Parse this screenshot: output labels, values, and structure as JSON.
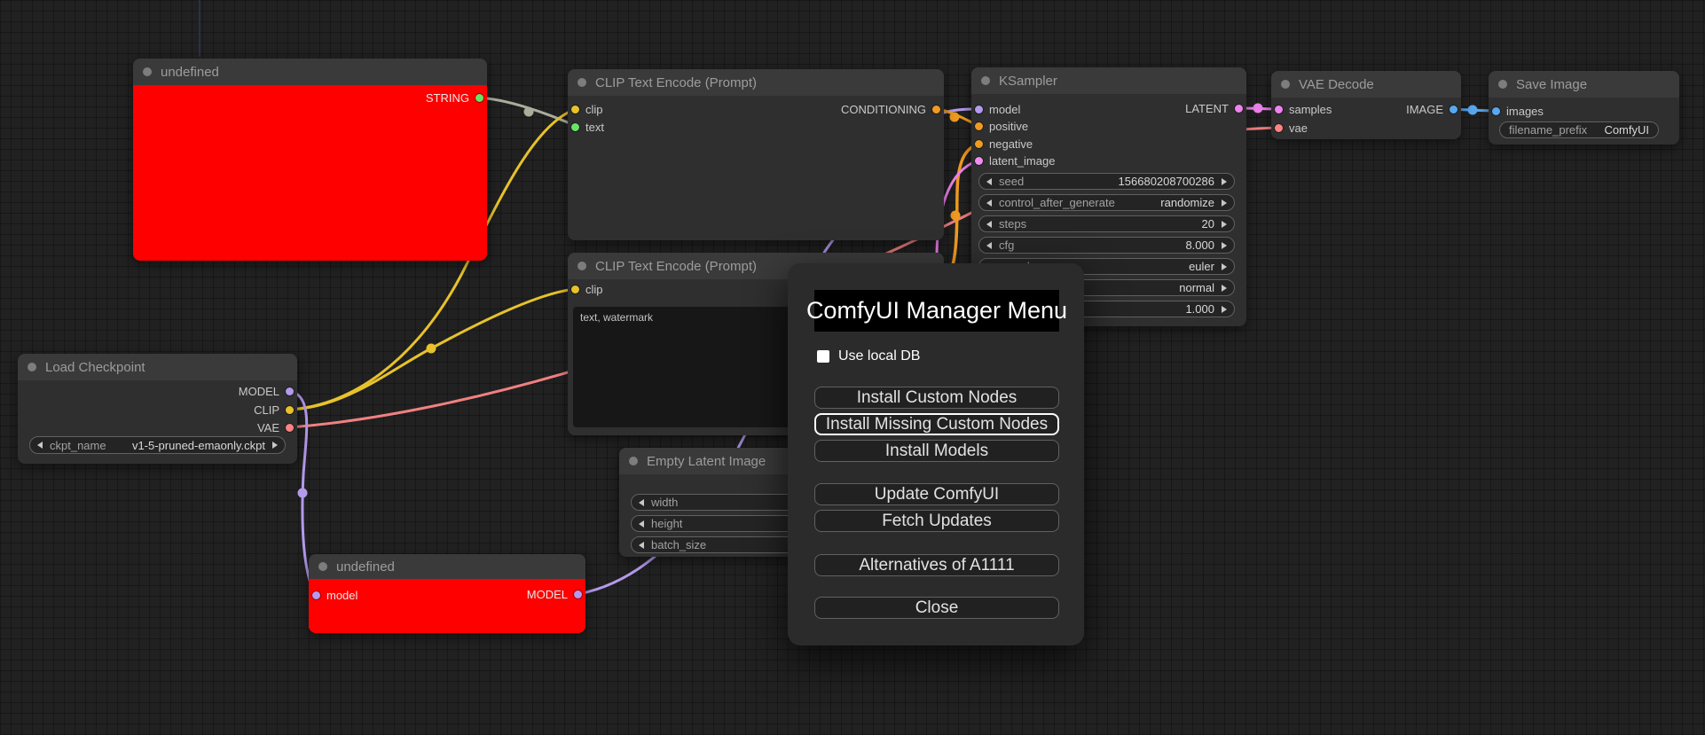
{
  "nodes": {
    "undefined_top": {
      "title": "undefined",
      "outputs": [
        "STRING"
      ]
    },
    "clip_encode_1": {
      "title": "CLIP Text Encode (Prompt)",
      "inputs": [
        "clip",
        "text"
      ],
      "outputs": [
        "CONDITIONING"
      ]
    },
    "clip_encode_2": {
      "title": "CLIP Text Encode (Prompt)",
      "inputs": [
        "clip"
      ],
      "text_value": "text, watermark"
    },
    "ksampler": {
      "title": "KSampler",
      "inputs": [
        "model",
        "positive",
        "negative",
        "latent_image"
      ],
      "outputs": [
        "LATENT"
      ],
      "widgets": [
        {
          "label": "seed",
          "value": "156680208700286"
        },
        {
          "label": "control_after_generate",
          "value": "randomize"
        },
        {
          "label": "steps",
          "value": "20"
        },
        {
          "label": "cfg",
          "value": "8.000"
        },
        {
          "label": "sampler_name",
          "value": "euler"
        },
        {
          "label": "",
          "value": "normal"
        },
        {
          "label": "",
          "value": "1.000"
        }
      ]
    },
    "vae_decode": {
      "title": "VAE Decode",
      "inputs": [
        "samples",
        "vae"
      ],
      "outputs": [
        "IMAGE"
      ]
    },
    "save_image": {
      "title": "Save Image",
      "inputs": [
        "images"
      ],
      "widgets": [
        {
          "label": "filename_prefix",
          "value": "ComfyUI"
        }
      ]
    },
    "load_checkpoint": {
      "title": "Load Checkpoint",
      "outputs": [
        "MODEL",
        "CLIP",
        "VAE"
      ],
      "widgets": [
        {
          "label": "ckpt_name",
          "value": "v1-5-pruned-emaonly.ckpt"
        }
      ]
    },
    "empty_latent": {
      "title": "Empty Latent Image",
      "widgets": [
        {
          "label": "width"
        },
        {
          "label": "height"
        },
        {
          "label": "batch_size"
        }
      ]
    },
    "undefined_bottom": {
      "title": "undefined",
      "inputs": [
        "model"
      ],
      "outputs": [
        "MODEL"
      ]
    }
  },
  "dialog": {
    "title": "ComfyUI Manager Menu",
    "checkbox": {
      "label": "Use local DB",
      "checked": false
    },
    "buttons": [
      "Install Custom Nodes",
      "Install Missing Custom Nodes",
      "Install Models",
      "Update ComfyUI",
      "Fetch Updates",
      "Alternatives of A1111",
      "Close"
    ]
  },
  "colors": {
    "node_red": "#fe0000",
    "wire_olive": "#a9ae9b",
    "wire_yellow": "#e7c22b",
    "wire_salmon": "#f28080",
    "wire_lavender": "#b49aec",
    "wire_orange": "#ef9b22",
    "wire_pink": "#ee82ee",
    "wire_blue": "#58a8f0",
    "slot_green": "#67e467",
    "slot_yellow": "#e7c22b",
    "slot_orange": "#ef9b22",
    "slot_lavender": "#b49aec",
    "slot_magenta": "#f08df0",
    "slot_orchid": "#ee82ee",
    "slot_salmon": "#ff8383",
    "slot_blue": "#58a8f0",
    "offscreen_wire_navy": "#2a3550"
  }
}
